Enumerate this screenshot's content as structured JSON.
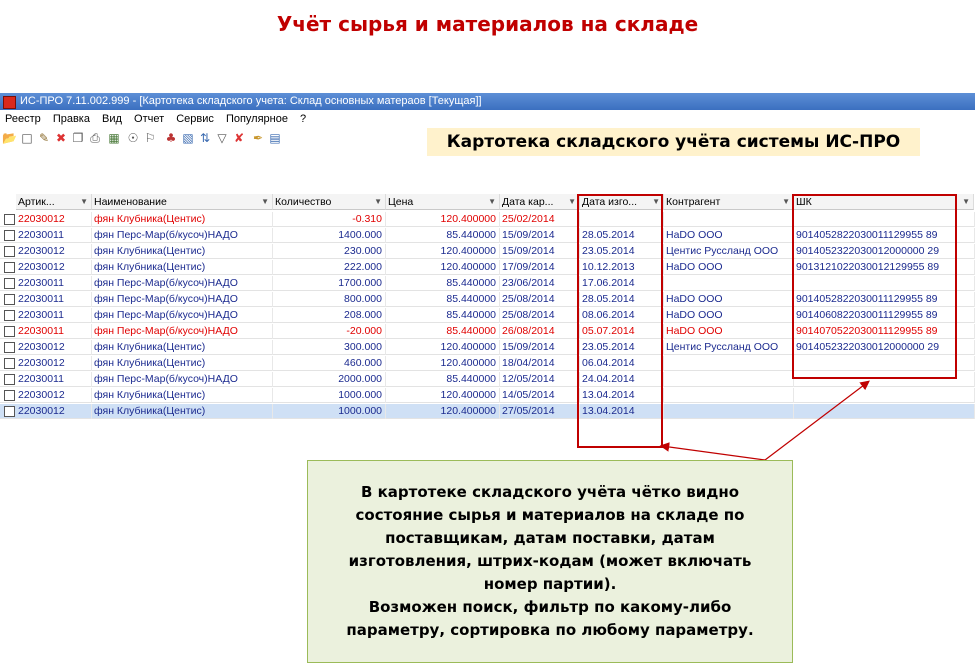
{
  "slide": {
    "title": "Учёт сырья и материалов на складе",
    "headline": "Картотека складского учёта системы ИС-ПРО",
    "note_lines": [
      "В картотеке складского учёта чётко видно",
      "состояние сырья и материалов на складе по",
      "поставщикам, датам поставки, датам",
      "изготовления,  штрих-кодам (может включать",
      "номер партии).",
      "Возможен поиск, фильтр по какому-либо",
      "параметру, сортировка по любому параметру."
    ]
  },
  "window": {
    "title": "ИС-ПРО 7.11.002.999 - [Картотека складского учета: Склад основных матераов [Текущая]]",
    "menu": [
      "Реестр",
      "Правка",
      "Вид",
      "Отчет",
      "Сервис",
      "Популярное",
      "?"
    ],
    "toolbar_icons": [
      "open-folder-icon",
      "new-document-icon",
      "edit-document-icon",
      "delete-icon",
      "copy-icon",
      "print-icon",
      "calculator-icon",
      "find-icon",
      "find-next-icon",
      "group-icon",
      "preview-icon",
      "sort-az-icon",
      "filter-icon",
      "clear-filter-icon",
      "export-icon",
      "properties-icon"
    ]
  },
  "table": {
    "columns": [
      "Артик...",
      "Наименование",
      "Количество",
      "Цена",
      "Дата кар...",
      "Дата изго...",
      "Контрагент",
      "ШК"
    ],
    "rows": [
      {
        "color": "red",
        "cells": [
          "22030012",
          "фян Клубника(Центис)",
          "-0.310",
          "120.400000",
          "25/02/2014",
          "",
          "",
          ""
        ]
      },
      {
        "color": "blue",
        "cells": [
          "22030011",
          "фян Перс-Мар(б/кусоч)НАДО",
          "1400.000",
          "85.440000",
          "15/09/2014",
          "28.05.2014",
          "НаDО ООО",
          "9014052822030011129955 89"
        ]
      },
      {
        "color": "blue",
        "cells": [
          "22030012",
          "фян Клубника(Центис)",
          "230.000",
          "120.400000",
          "15/09/2014",
          "23.05.2014",
          "Центис Руссланд ООО",
          "9014052322030012000000 29"
        ]
      },
      {
        "color": "blue",
        "cells": [
          "22030012",
          "фян Клубника(Центис)",
          "222.000",
          "120.400000",
          "17/09/2014",
          "10.12.2013",
          "НаDО ООО",
          "9013121022030012129955 89"
        ]
      },
      {
        "color": "blue",
        "cells": [
          "22030011",
          "фян Перс-Мар(б/кусоч)НАДО",
          "1700.000",
          "85.440000",
          "23/06/2014",
          "17.06.2014",
          "",
          ""
        ]
      },
      {
        "color": "blue",
        "cells": [
          "22030011",
          "фян Перс-Мар(б/кусоч)НАДО",
          "800.000",
          "85.440000",
          "25/08/2014",
          "28.05.2014",
          "НаDО ООО",
          "9014052822030011129955 89"
        ]
      },
      {
        "color": "blue",
        "cells": [
          "22030011",
          "фян Перс-Мар(б/кусоч)НАДО",
          "208.000",
          "85.440000",
          "25/08/2014",
          "08.06.2014",
          "НаDО ООО",
          "9014060822030011129955 89"
        ]
      },
      {
        "color": "red",
        "cells": [
          "22030011",
          "фян Перс-Мар(б/кусоч)НАДО",
          "-20.000",
          "85.440000",
          "26/08/2014",
          "05.07.2014",
          "НаDО ООО",
          "9014070522030011129955 89"
        ]
      },
      {
        "color": "blue",
        "cells": [
          "22030012",
          "фян Клубника(Центис)",
          "300.000",
          "120.400000",
          "15/09/2014",
          "23.05.2014",
          "Центис Руссланд ООО",
          "9014052322030012000000 29"
        ]
      },
      {
        "color": "blue",
        "cells": [
          "22030012",
          "фян Клубника(Центис)",
          "460.000",
          "120.400000",
          "18/04/2014",
          "06.04.2014",
          "",
          ""
        ]
      },
      {
        "color": "blue",
        "cells": [
          "22030011",
          "фян Перс-Мар(б/кусоч)НАДО",
          "2000.000",
          "85.440000",
          "12/05/2014",
          "24.04.2014",
          "",
          ""
        ]
      },
      {
        "color": "blue",
        "cells": [
          "22030012",
          "фян Клубника(Центис)",
          "1000.000",
          "120.400000",
          "14/05/2014",
          "13.04.2014",
          "",
          ""
        ]
      },
      {
        "color": "blue",
        "selected": true,
        "cells": [
          "22030012",
          "фян Клубника(Центис)",
          "1000.000",
          "120.400000",
          "27/05/2014",
          "13.04.2014",
          "",
          ""
        ]
      }
    ]
  }
}
